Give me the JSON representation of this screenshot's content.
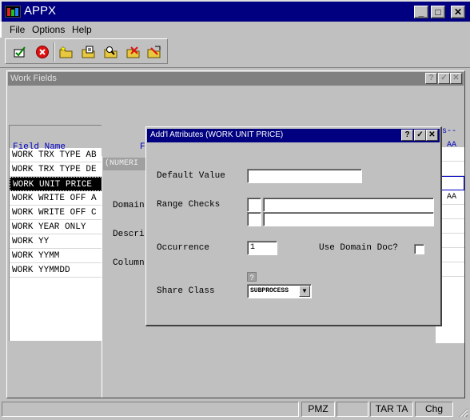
{
  "app": {
    "title": "APPX",
    "controls": {
      "minimize": "_",
      "maximize": "□",
      "close": "✕"
    }
  },
  "menu": [
    "File",
    "Options",
    "Help"
  ],
  "toolbar": [
    {
      "name": "checkmark-icon"
    },
    {
      "name": "cancel-icon"
    },
    {
      "name": "add-record-icon"
    },
    {
      "name": "change-record-icon"
    },
    {
      "name": "inquire-record-icon"
    },
    {
      "name": "delete-record-icon"
    }
  ],
  "work_fields": {
    "title": "Work Fields",
    "columns": {
      "name": "Field Name",
      "f": "F",
      "right_header": "s--",
      "right_col": "AA"
    },
    "rows": [
      "WORK TRX TYPE AB",
      "WORK TRX TYPE DE",
      "WORK UNIT PRICE",
      "WORK WRITE OFF A",
      "WORK WRITE OFF C",
      "WORK YEAR ONLY",
      "WORK YY",
      "WORK YYMM",
      "WORK YYMMDD"
    ],
    "selected_index": 2,
    "right_values": [
      "",
      "",
      "",
      "AA",
      "",
      "",
      "",
      "",
      ""
    ],
    "mid_panel": {
      "numeric_label": "(NUMERI",
      "domain_label": "Domain",
      "descri_label": "Descri",
      "column_label": "Column"
    }
  },
  "dialog": {
    "title": "Add'l Attributes (WORK UNIT PRICE)",
    "controls": {
      "help": "?",
      "ok": "✓",
      "close": "✕"
    },
    "default_value_label": "Default Value",
    "default_value": "",
    "range_checks_label": "Range Checks",
    "range_checks": [
      {
        "op": "",
        "value": ""
      },
      {
        "op": "",
        "value": ""
      }
    ],
    "occurrence_label": "Occurrence",
    "occurrence": "1",
    "use_domain_doc_label": "Use Domain Doc?",
    "use_domain_doc": false,
    "share_class_label": "Share Class",
    "share_class": "SUBPROCESS",
    "help_icon": "?"
  },
  "status": [
    "PMZ",
    "",
    "TAR TA",
    "Chg"
  ]
}
